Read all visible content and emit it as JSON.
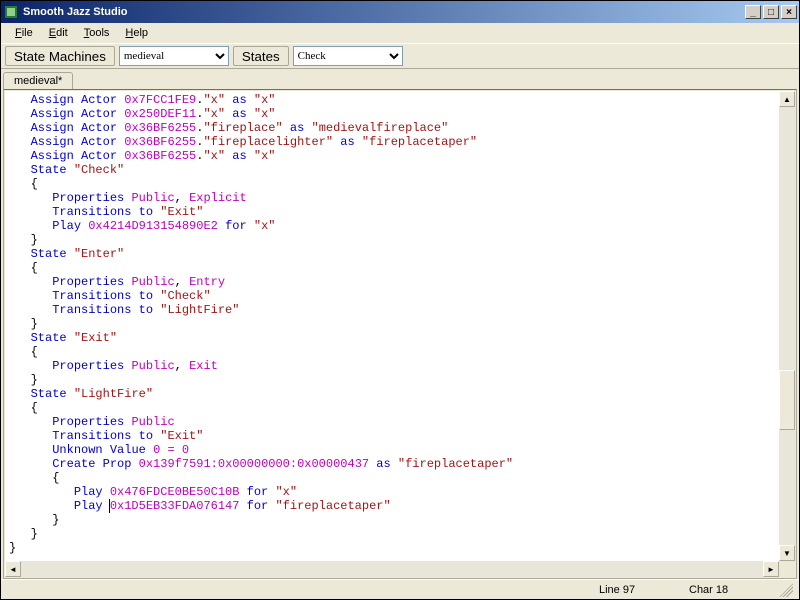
{
  "window": {
    "title": "Smooth Jazz Studio"
  },
  "menu": {
    "file": "File",
    "edit": "Edit",
    "tools": "Tools",
    "help": "Help"
  },
  "toolbar": {
    "stateMachines_label": "State Machines",
    "stateMachines_value": "medieval",
    "states_label": "States",
    "states_value": "Check"
  },
  "tabs": {
    "active": "medieval*"
  },
  "status": {
    "line_label": "Line",
    "line": "97",
    "char_label": "Char",
    "char": "18"
  },
  "kw": {
    "assign": "Assign",
    "actor": "Actor",
    "as": "as",
    "state": "State",
    "properties": "Properties",
    "public": "Public",
    "explicit": "Explicit",
    "entry": "Entry",
    "exit": "Exit",
    "transitions": "Transitions",
    "to": "to",
    "play": "Play",
    "for": "for",
    "create": "Create",
    "prop": "Prop",
    "unknown": "Unknown",
    "value": "Value"
  },
  "ids": {
    "a1": "0x7FCC1FE9",
    "a2": "0x250DEF11",
    "a3": "0x36BF6255",
    "p_check": "0x4214D913154890E2",
    "prop": "0x139f7591:0x00000000:0x00000437",
    "p_x": "0x476FDCE0BE50C10B",
    "p_ft": "0x1D5EB33FDA076147"
  },
  "str": {
    "x": "\"x\"",
    "fireplace": "\"fireplace\"",
    "medfire": "\"medievalfireplace\"",
    "firelighter": "\"fireplacelighter\"",
    "firetaper": "\"fireplacetaper\"",
    "check": "\"Check\"",
    "enter": "\"Enter\"",
    "exit": "\"Exit\"",
    "lightfire": "\"LightFire\"",
    "zero": "0 = 0"
  },
  "punct": {
    "dot": ".",
    "comma": ",",
    "lb": "{",
    "rb": "}"
  }
}
